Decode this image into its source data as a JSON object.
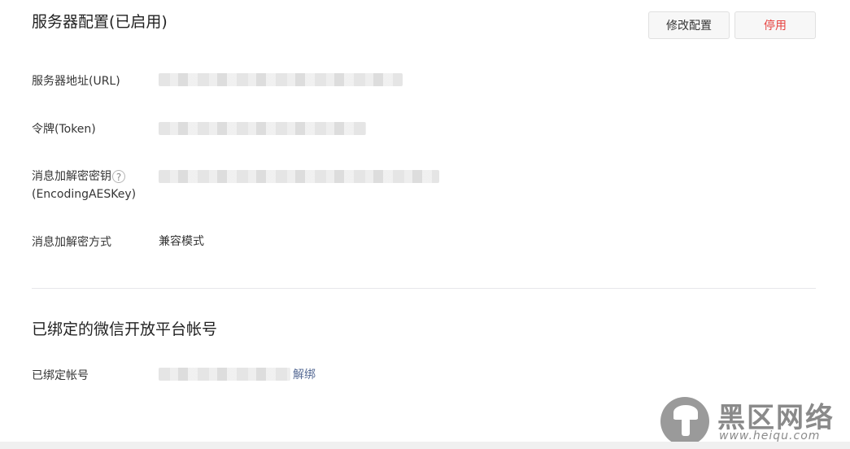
{
  "server_config": {
    "title": "服务器配置(已启用)",
    "edit_button": "修改配置",
    "disable_button": "停用",
    "fields": {
      "url_label": "服务器地址(URL)",
      "token_label": "令牌(Token)",
      "aeskey_label_line1": "消息加解密密钥",
      "aeskey_label_line2": "(EncodingAESKey)",
      "help_glyph": "?",
      "encrypt_mode_label": "消息加解密方式",
      "encrypt_mode_value": "兼容模式"
    }
  },
  "bound_account": {
    "title": "已绑定的微信开放平台帐号",
    "label": "已绑定帐号",
    "unbind_link": "解绑"
  },
  "watermark": {
    "text": "黑区网络",
    "url": "www.heiqu.com"
  },
  "colors": {
    "danger": "#e64340",
    "link": "#576b95"
  }
}
